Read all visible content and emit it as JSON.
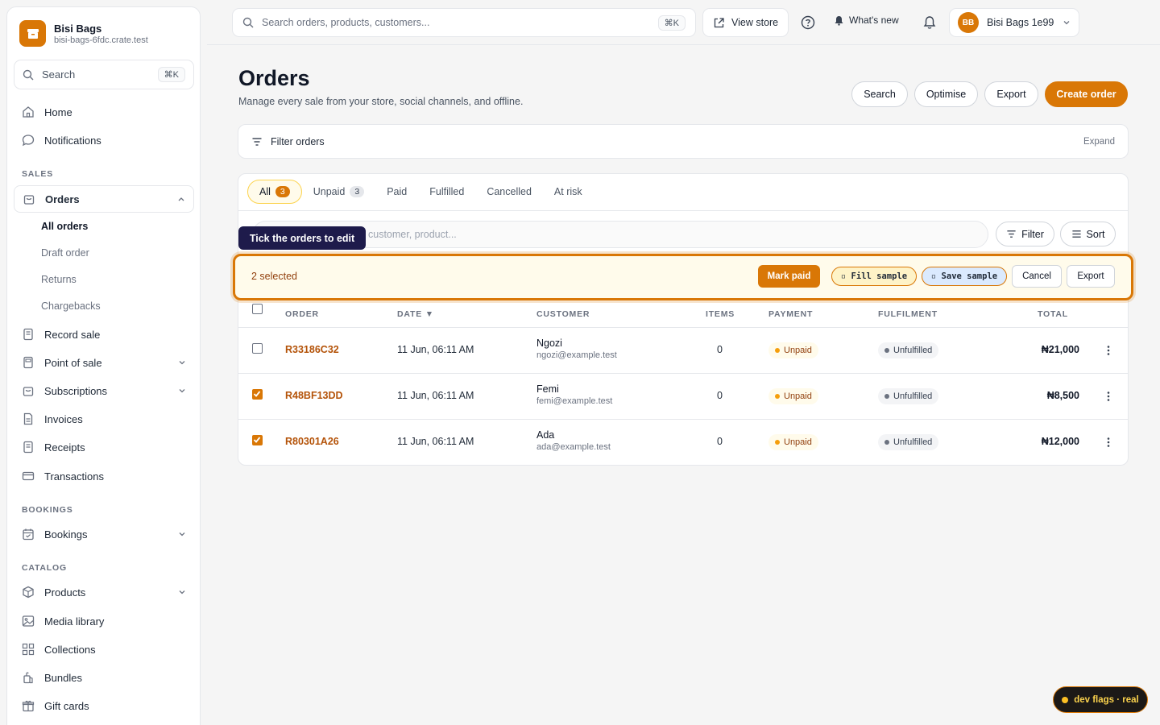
{
  "brand": {
    "name": "Bisi Bags",
    "domain": "bisi-bags-6fdc.crate.test"
  },
  "sidebar": {
    "search_label": "Search",
    "search_kbd": "⌘K",
    "top_items": [
      {
        "label": "Home",
        "icon": "home-icon"
      },
      {
        "label": "Notifications",
        "icon": "chat-bubble-icon"
      }
    ],
    "sections": {
      "sales": "SALES",
      "bookings": "BOOKINGS",
      "catalog": "CATALOG"
    },
    "orders": {
      "label": "Orders",
      "sub_items": [
        "All orders",
        "Draft order",
        "Returns",
        "Chargebacks"
      ]
    },
    "sales_items": [
      {
        "label": "Record sale"
      },
      {
        "label": "Point of sale"
      },
      {
        "label": "Subscriptions"
      },
      {
        "label": "Invoices"
      },
      {
        "label": "Receipts"
      },
      {
        "label": "Transactions"
      }
    ],
    "bookings_items": [
      {
        "label": "Bookings"
      }
    ],
    "catalog_items": [
      {
        "label": "Products"
      },
      {
        "label": "Media library"
      },
      {
        "label": "Collections"
      },
      {
        "label": "Bundles"
      },
      {
        "label": "Gift cards"
      }
    ]
  },
  "topbar": {
    "search_placeholder": "Search orders, products, customers...",
    "search_kbd": "⌘K",
    "view_store": "View store",
    "whats_new": "What's new",
    "account_initials": "BB",
    "account_name": "Bisi Bags 1e99"
  },
  "page": {
    "title": "Orders",
    "subtitle": "Manage every sale from your store, social channels, and offline.",
    "actions": [
      "Search",
      "Optimise",
      "Export",
      "Create order"
    ]
  },
  "filter_card": {
    "label": "Filter orders",
    "expand": "Expand"
  },
  "tabs": [
    {
      "label": "All",
      "count": "3",
      "active": true
    },
    {
      "label": "Unpaid",
      "count": "3"
    },
    {
      "label": "Paid"
    },
    {
      "label": "Fulfilled"
    },
    {
      "label": "Cancelled"
    },
    {
      "label": "At risk"
    }
  ],
  "list": {
    "search_placeholder": "customer, product...",
    "filter": "Filter",
    "sort": "Sort"
  },
  "tooltip": "Tick the orders to edit",
  "bulk": {
    "selected": "2 selected",
    "mark_paid": "Mark paid",
    "fill_sample": "▫ Fill sample",
    "save_sample": "▫ Save sample",
    "cancel": "Cancel",
    "export": "Export"
  },
  "table": {
    "headers": [
      "ORDER",
      "DATE ▼",
      "CUSTOMER",
      "ITEMS",
      "PAYMENT",
      "FULFILMENT",
      "TOTAL"
    ],
    "rows": [
      {
        "id": "R33186C32",
        "date": "11 Jun, 06:11 AM",
        "name": "Ngozi",
        "email": "ngozi@example.test",
        "items": "0",
        "payment": "Unpaid",
        "fulfilment": "Unfulfilled",
        "total": "₦21,000",
        "checked": false
      },
      {
        "id": "R48BF13DD",
        "date": "11 Jun, 06:11 AM",
        "name": "Femi",
        "email": "femi@example.test",
        "items": "0",
        "payment": "Unpaid",
        "fulfilment": "Unfulfilled",
        "total": "₦8,500",
        "checked": true
      },
      {
        "id": "R80301A26",
        "date": "11 Jun, 06:11 AM",
        "name": "Ada",
        "email": "ada@example.test",
        "items": "0",
        "payment": "Unpaid",
        "fulfilment": "Unfulfilled",
        "total": "₦12,000",
        "checked": true
      }
    ]
  },
  "dev_flags": "dev flags · real",
  "colors": {
    "accent": "#d97706",
    "unpaid_dot": "#f59e0b",
    "unfulfilled_dot": "#6b7280"
  }
}
